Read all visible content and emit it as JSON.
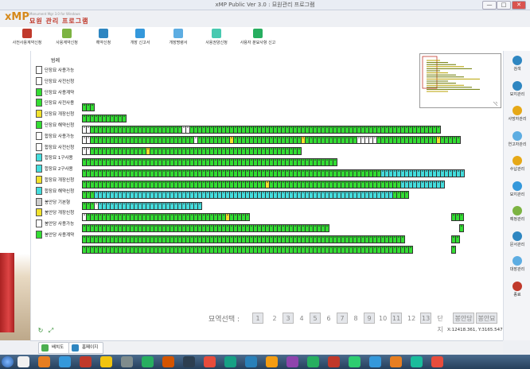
{
  "window": {
    "title": "xMP Public Ver 3.0 : 묘원관리 프로그램",
    "min": "—",
    "max": "□",
    "close": "✕"
  },
  "logo": {
    "brand": "xMP",
    "subtitle": "Monument Mgr 3.0 for Windows",
    "system": "묘원 관리 프로그램"
  },
  "toolbar": [
    {
      "label": "사전사용계약신청",
      "icon": "calendar-icon",
      "color": "#c0392b"
    },
    {
      "label": "사용계약신청",
      "icon": "pen-icon",
      "color": "#7cb342"
    },
    {
      "label": "해약신청",
      "icon": "box-icon",
      "color": "#2e86c1"
    },
    {
      "label": "개장 신고서",
      "icon": "monitor-icon",
      "color": "#3498db"
    },
    {
      "label": "개장명령서",
      "icon": "document-icon",
      "color": "#5dade2"
    },
    {
      "label": "사용권양신청",
      "icon": "transfer-icon",
      "color": "#48c9b0"
    },
    {
      "label": "사용자 분묘사항 신고",
      "icon": "puzzle-icon",
      "color": "#27ae60"
    }
  ],
  "legend": {
    "title": "범례",
    "items": [
      {
        "label": "단장묘 사용가능",
        "color": "#ffffff"
      },
      {
        "label": "단장묘 사전신청",
        "color": "#ffffff"
      },
      {
        "label": "단장묘 사용계약",
        "color": "#33dd33"
      },
      {
        "label": "단장묘 사전사용",
        "color": "#33dd33"
      },
      {
        "label": "단장묘 개장신청",
        "color": "#f2e22c"
      },
      {
        "label": "단장묘 해약신청",
        "color": "#33dd33"
      },
      {
        "label": "합장묘 사용가능",
        "color": "#ffffff"
      },
      {
        "label": "합장묘 사전신청",
        "color": "#ffffff"
      },
      {
        "label": "합장묘 1구사용",
        "color": "#44dddd"
      },
      {
        "label": "합장묘 2구사용",
        "color": "#44dddd"
      },
      {
        "label": "합장묘 개장신청",
        "color": "#f2e22c"
      },
      {
        "label": "합장묘 해약신청",
        "color": "#44dddd"
      },
      {
        "label": "봉안당 기본형",
        "color": "#cccccc"
      },
      {
        "label": "봉안당 개장신청",
        "color": "#f2e22c"
      },
      {
        "label": "봉안당 사용가능",
        "color": "#ffffff"
      },
      {
        "label": "봉안당 사용계약",
        "color": "#33dd33"
      }
    ]
  },
  "grid": {
    "colors": {
      "green": "#33dd33",
      "cyan": "#44dddd",
      "white": "#ffffff",
      "yellow": "#f2e22c",
      "gray": "#cccccc"
    },
    "cell_glyph": "A",
    "rows": [
      {
        "offset": 0,
        "cells": "ggg"
      },
      {
        "offset": 0,
        "cells": "ggggggggggg"
      },
      {
        "offset": 0,
        "cells": "wwgggggggggggggggggggggggwwggggggggggggggggggggggggggggggggggggggggggggggggggggggggggggggg"
      },
      {
        "offset": 0,
        "cells": "wwggggggggggggggggggggggggggwggggggggygggggggggggggggggygggggggggggggwwwwwgggggggggggggggyggggg"
      },
      {
        "offset": 0,
        "cells": "wwggggggggggggggygggggggggggggggggggggggggggggggggggggg"
      },
      {
        "offset": 0,
        "cells": "gggggggggggggggggggggggggggggggggggggggggggggggggggggggggggggggg"
      },
      {
        "offset": 0,
        "cells": "gggggggggggggggggggggggggggggggggggggggggggggggggggggggggggggggggggggggggggccccccccccccccccccccc"
      },
      {
        "offset": 0,
        "cells": "ggggggggggggggggggggggggggggggggggggggggggggggygggggggggggggggggggggggggggggggggccccccccccc"
      },
      {
        "offset": 0,
        "cells": "gggcccccccccccccccccccccccccccccccccccccccccccccccccccccccccccccccccccccccccccgggg"
      },
      {
        "offset": 0,
        "cells": "gggwcccccccccccccccccccccccccc"
      },
      {
        "offset": 0,
        "cells": "wgggggggggggggggggggggggggggggggggggyggggg"
      },
      {
        "offset": 0,
        "cells": "gggggggggggggggggggggggggggggggggggggggggggggggggggggggggggggg"
      },
      {
        "offset": 0,
        "cells": "ggggggggggggggggggggggggggggggggggggggggggggggggggggggggggggggggggggggggggggggggg"
      },
      {
        "offset": 0,
        "cells": "ggggggggggggggggggggggggggggggggggggggggggggggggggggggggggggggggggggggggggggggggggg"
      }
    ]
  },
  "pager": {
    "label": "묘역선택 :",
    "pages": [
      "1",
      "2",
      "3",
      "4",
      "5",
      "6",
      "7",
      "8",
      "9",
      "10",
      "11",
      "12",
      "13",
      "단지",
      "봉안당",
      "봉안묘"
    ],
    "boxed": [
      0,
      2,
      4,
      6,
      8,
      10,
      12,
      14,
      15
    ]
  },
  "coords": "X:12418.361, Y:3165.547",
  "tabs": [
    {
      "label": "배치도",
      "color": "#4caf50"
    },
    {
      "label": "홈페이지",
      "color": "#2e86c1"
    }
  ],
  "sidebar": [
    {
      "label": "검색",
      "icon": "search-icon",
      "color": "#2e86c1"
    },
    {
      "label": "묘지관리",
      "icon": "graves-icon",
      "color": "#2e86c1"
    },
    {
      "label": "사망자관리",
      "icon": "person-icon",
      "color": "#e6a817"
    },
    {
      "label": "연고자관리",
      "icon": "people-icon",
      "color": "#5dade2"
    },
    {
      "label": "수납관리",
      "icon": "money-icon",
      "color": "#e6a817"
    },
    {
      "label": "묘지관리",
      "icon": "tree-icon",
      "color": "#3498db"
    },
    {
      "label": "예정관리",
      "icon": "check-icon",
      "color": "#7cb342"
    },
    {
      "label": "문서관리",
      "icon": "docs-icon",
      "color": "#2e86c1"
    },
    {
      "label": "대장관리",
      "icon": "ledger-icon",
      "color": "#5dade2"
    },
    {
      "label": "종료",
      "icon": "exit-icon",
      "color": "#c0392b"
    }
  ],
  "taskbar": {
    "icon_colors": [
      "#f0f0f0",
      "#e67e22",
      "#3498db",
      "#c0392b",
      "#f1c40f",
      "#7f8c8d",
      "#27ae60",
      "#d35400",
      "#2c3e50",
      "#e74c3c",
      "#16a085",
      "#2980b9",
      "#f39c12",
      "#8e44ad",
      "#27ae60",
      "#c0392b",
      "#2ecc71",
      "#3498db",
      "#e67e22",
      "#1abc9c",
      "#e74c3c"
    ]
  }
}
